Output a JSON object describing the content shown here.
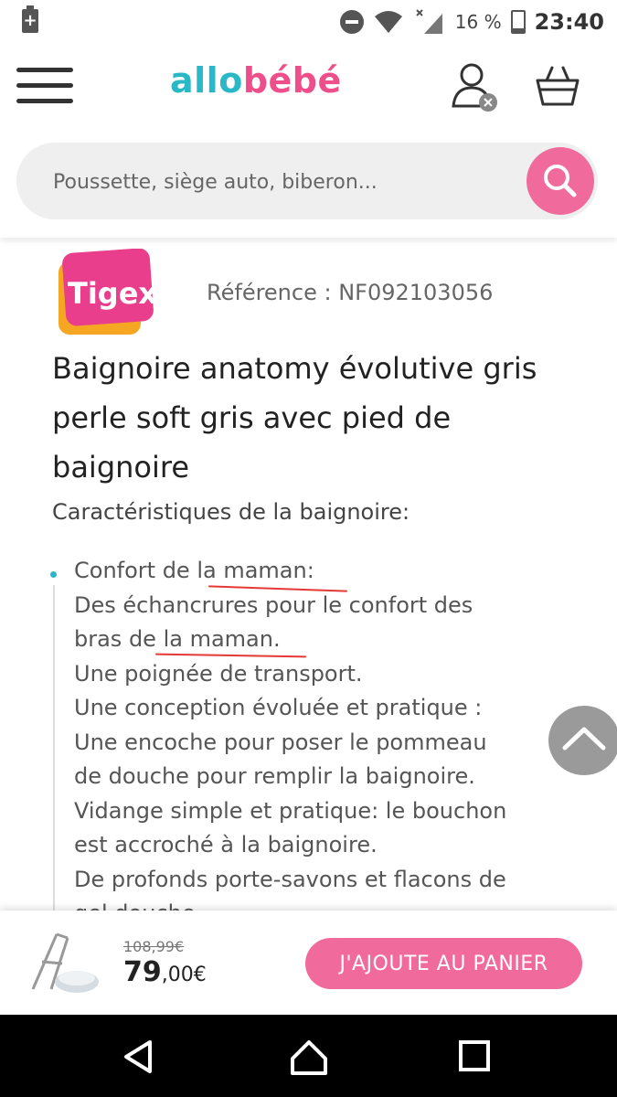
{
  "status_bar": {
    "battery_percent": "16 %",
    "time": "23:40"
  },
  "header": {
    "logo_part1": "allo",
    "logo_part2": "bébé",
    "icons": [
      "menu-icon",
      "user-icon",
      "cart-icon"
    ]
  },
  "search": {
    "placeholder": "Poussette, siège auto, biberon...",
    "value": ""
  },
  "product": {
    "brand_logo": "Tigex",
    "reference": "Référence : NF092103056",
    "title": "Baignoire anatomy évolutive gris perle soft gris avec pied de baignoire",
    "subtitle": "Caractéristiques de la baignoire:",
    "description_lines": [
      "Confort de la maman:",
      "Des échancrures pour le confort des",
      "bras de la maman.",
      "Une poignée de transport.",
      "Une conception évoluée et pratique :",
      "Une encoche pour poser le pommeau",
      "de douche pour remplir la baignoire.",
      "Vidange simple et pratique: le bouchon",
      "est accroché à la baignoire.",
      "De profonds porte-savons et flacons de",
      "gel douche."
    ]
  },
  "purchase": {
    "old_price": "108,99€",
    "price_main": "79",
    "price_cents": ",00€",
    "cta_label": "J'AJOUTE AU PANIER"
  },
  "colors": {
    "brand_teal": "#2bb8c6",
    "brand_pink": "#ee4f8a",
    "button_pink": "#f06b9b"
  }
}
